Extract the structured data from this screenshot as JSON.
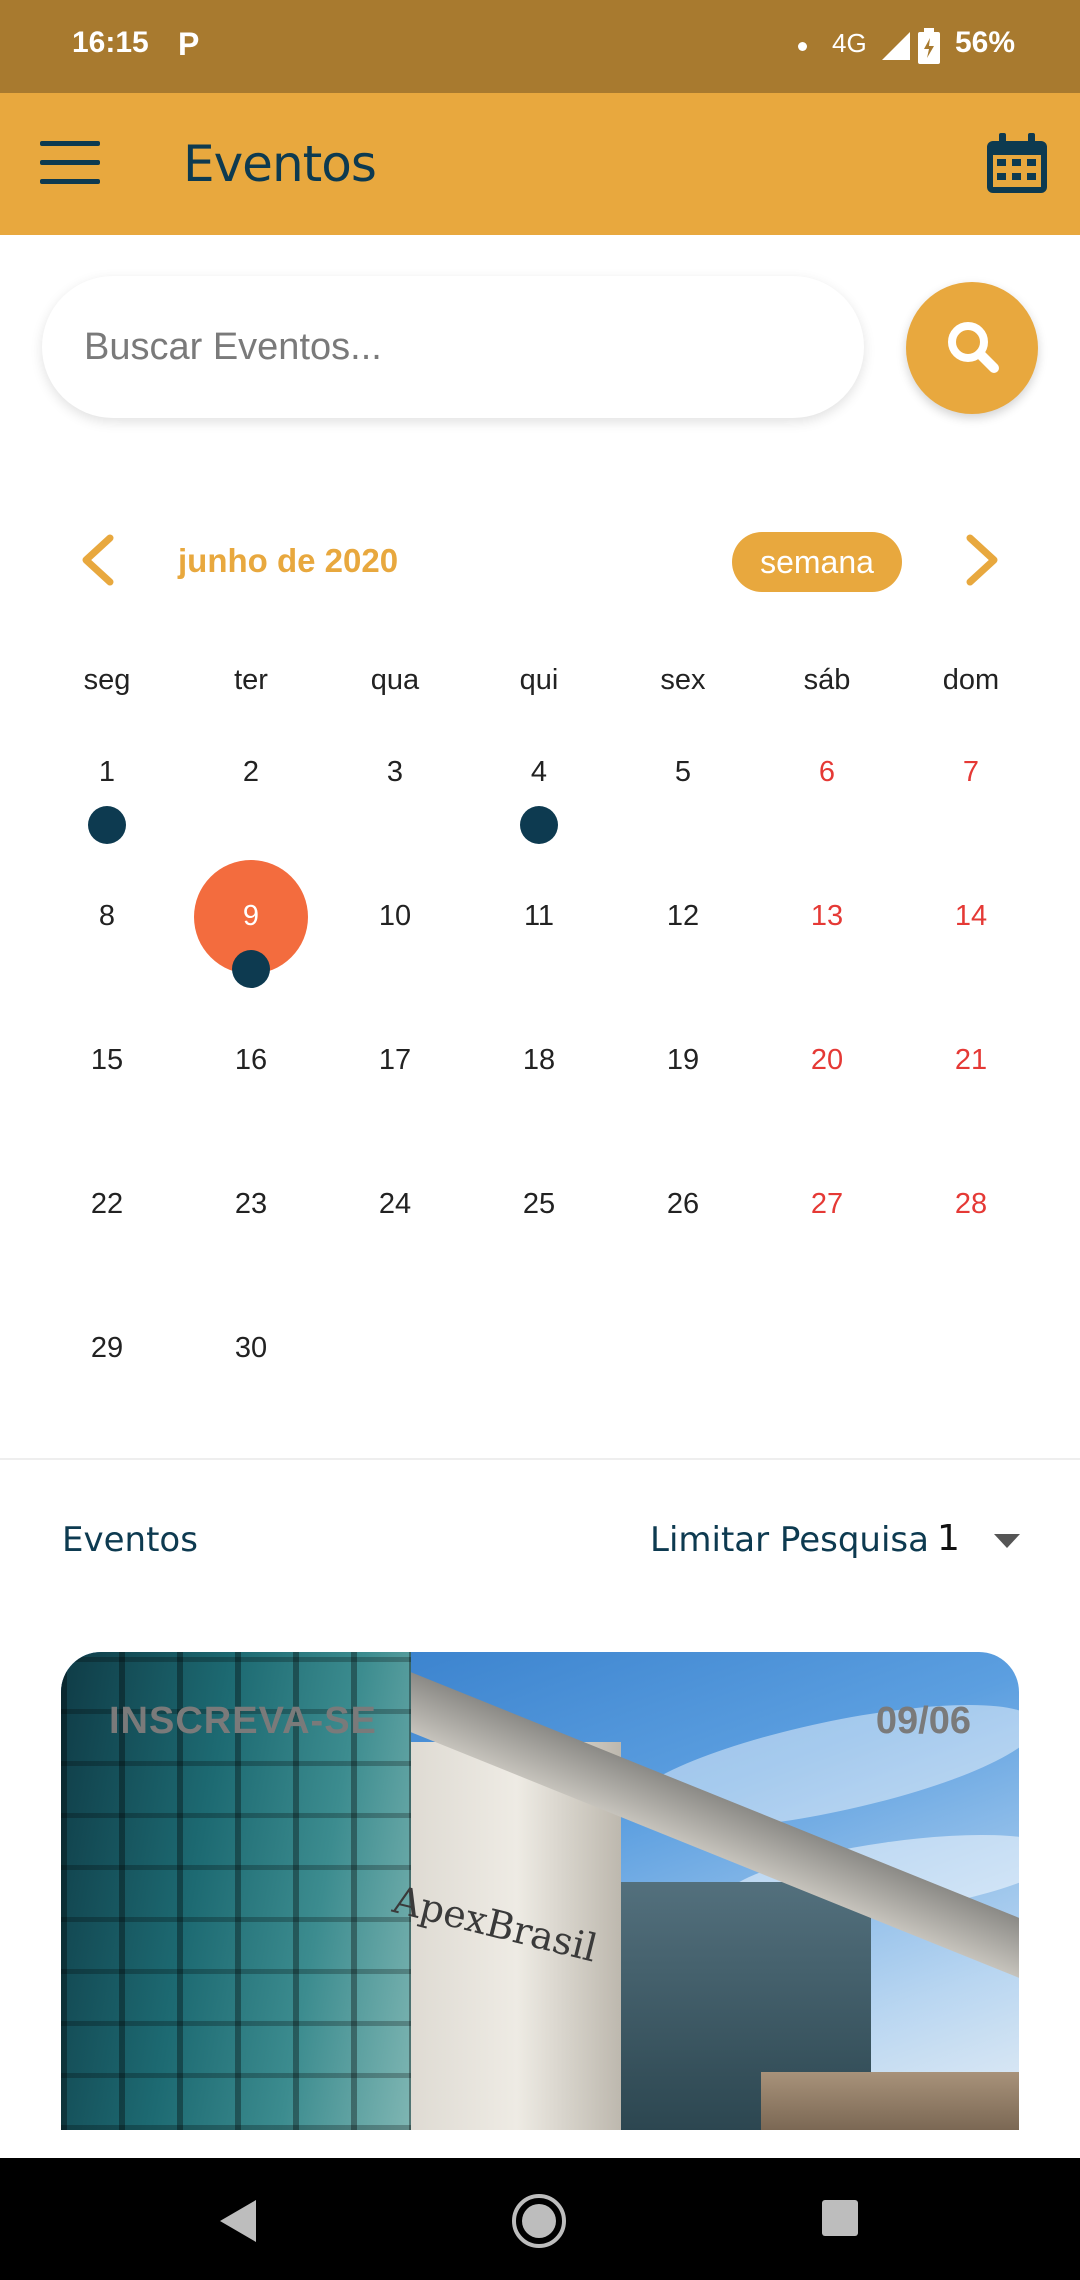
{
  "status_bar": {
    "time": "16:15",
    "app_icon": "P",
    "network": "4G",
    "battery": "56%"
  },
  "app_bar": {
    "title": "Eventos",
    "menu_icon": "hamburger-menu-icon",
    "calendar_icon": "calendar-icon"
  },
  "search": {
    "placeholder": "Buscar Eventos...",
    "value": "",
    "button_icon": "search-icon"
  },
  "calendar": {
    "month_label": "junho de 2020",
    "view_toggle": "semana",
    "weekdays": [
      "seg",
      "ter",
      "qua",
      "qui",
      "sex",
      "sáb",
      "dom"
    ],
    "weeks": [
      [
        "1",
        "2",
        "3",
        "4",
        "5",
        "6",
        "7"
      ],
      [
        "8",
        "9",
        "10",
        "11",
        "12",
        "13",
        "14"
      ],
      [
        "15",
        "16",
        "17",
        "18",
        "19",
        "20",
        "21"
      ],
      [
        "22",
        "23",
        "24",
        "25",
        "26",
        "27",
        "28"
      ],
      [
        "29",
        "30"
      ]
    ],
    "selected_day": "9",
    "event_days": [
      "1",
      "4",
      "9"
    ],
    "colors": {
      "accent": "#E8A83E",
      "selected": "#F36C3E",
      "weekend": "#E53935",
      "event_dot": "#0D3A50"
    }
  },
  "events_section": {
    "title": "Eventos",
    "limit_label": "Limitar Pesquisa",
    "limit_value": "1"
  },
  "event_card": {
    "tag": "INSCREVA-SE",
    "date": "09/06",
    "image_logo_text": "ApexBrasil"
  }
}
